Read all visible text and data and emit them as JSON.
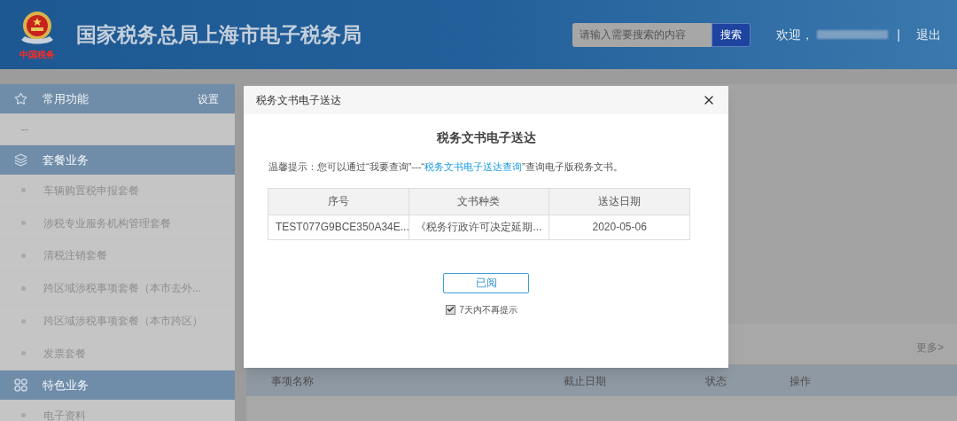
{
  "header": {
    "logo_caption": "中国税务",
    "title": "国家税务总局上海市电子税务局",
    "search": {
      "placeholder": "请输入需要搜索的内容",
      "button": "搜索"
    },
    "welcome": "欢迎，",
    "separator": "|",
    "logout": "退出"
  },
  "sidebar": {
    "sections": [
      {
        "kind": "star",
        "title": "常用功能",
        "action": "设置",
        "items": [
          {
            "label": "--",
            "kind": "plain"
          }
        ]
      },
      {
        "kind": "layers",
        "title": "套餐业务",
        "items": [
          {
            "label": "车辆购置税申报套餐",
            "kind": "bullet"
          },
          {
            "label": "涉税专业服务机构管理套餐",
            "kind": "bullet"
          },
          {
            "label": "清税注销套餐",
            "kind": "bullet"
          },
          {
            "label": "跨区域涉税事项套餐（本市去外...",
            "kind": "bullet"
          },
          {
            "label": "跨区域涉税事项套餐（本市跨区）",
            "kind": "bullet"
          },
          {
            "label": "发票套餐",
            "kind": "bullet"
          }
        ]
      },
      {
        "kind": "grid",
        "title": "特色业务",
        "items": [
          {
            "label": "电子资料",
            "kind": "bullet"
          }
        ]
      }
    ]
  },
  "main": {
    "more": "更多>",
    "table": {
      "columns": [
        "事项名称",
        "截止日期",
        "状态",
        "操作"
      ]
    }
  },
  "dialog": {
    "title": "税务文书电子送达",
    "heading": "税务文书电子送达",
    "tip": {
      "before": "温馨提示：您可以通过“我要查询”---“",
      "link": "税务文书电子送达查询",
      "after": "”查询电子版税务文书。"
    },
    "table": {
      "columns": [
        "序号",
        "文书种类",
        "送达日期"
      ],
      "rows": [
        [
          "TEST077G9BCE350A34E...",
          "《税务行政许可决定延期...",
          "2020-05-06"
        ]
      ]
    },
    "button": "已阅",
    "checkbox": {
      "label": "7天内不再提示",
      "checked": true
    }
  }
}
